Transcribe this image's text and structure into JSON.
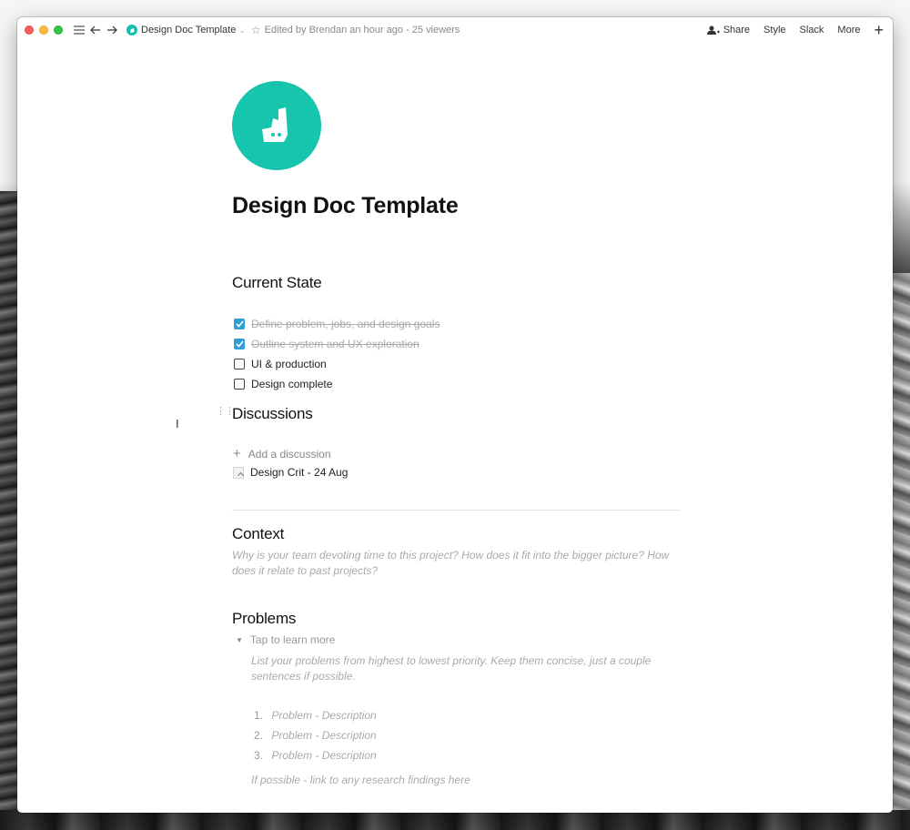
{
  "window": {
    "doc_title": "Design Doc Template",
    "edited_status": "Edited by Brendan an hour ago - 25 viewers",
    "share_label": "Share",
    "style_label": "Style",
    "slack_label": "Slack",
    "more_label": "More",
    "plus_label": "+"
  },
  "page": {
    "title": "Design Doc Template",
    "current_state": {
      "heading": "Current State",
      "items": [
        {
          "label": "Define problem, jobs, and design goals",
          "checked": true
        },
        {
          "label": "Outline system and UX exploration",
          "checked": true
        },
        {
          "label": "UI & production",
          "checked": false
        },
        {
          "label": "Design complete",
          "checked": false
        }
      ]
    },
    "discussions": {
      "heading": "Discussions",
      "add_label": "Add a discussion",
      "items": [
        "Design Crit - 24 Aug"
      ]
    },
    "context": {
      "heading": "Context",
      "placeholder": "Why is your team devoting time to this project? How does it fit into the bigger picture? How does it relate to past projects?"
    },
    "problems": {
      "heading": "Problems",
      "toggle_label": "Tap to learn more",
      "intro": "List your problems from highest to lowest priority. Keep them concise, just a couple sentences if possible.",
      "items": [
        {
          "num": "1.",
          "text": "Problem - Description"
        },
        {
          "num": "2.",
          "text": "Problem - Description"
        },
        {
          "num": "3.",
          "text": "Problem - Description"
        }
      ],
      "footer": "If possible - link to any research findings here"
    }
  },
  "colors": {
    "brand_teal": "#17c4ac",
    "checkbox_blue": "#2f9fd8"
  }
}
